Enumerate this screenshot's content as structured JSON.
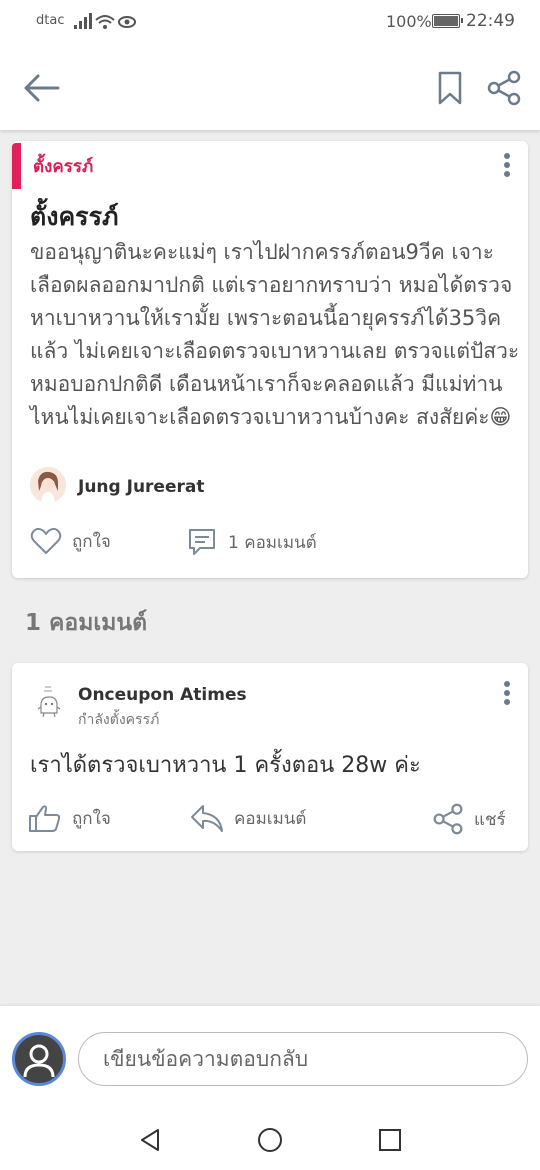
{
  "status_bar": {
    "carrier": "dtac",
    "battery": "100%",
    "battery_level": 1.0,
    "time": "22:49"
  },
  "app_bar": {
    "back_icon": "back-arrow-icon",
    "bookmark_icon": "bookmark-icon",
    "share_icon": "share-icon"
  },
  "post": {
    "tag": "ตั้งครรภ์",
    "title": "ตั้งครรภ์",
    "body": "ขออนุญาตินะคะแม่ๆ เราไปฝากครรภ์ตอน9วีค เจาะเลือดผลออกมาปกติ แต่เราอยากทราบว่า หมอได้ตรวจหาเบาหวานให้เรามั้ย เพราะตอนนี้อายุครรภ์ได้35วิคแล้ว ไม่เคยเจาะเลือดตรวจเบาหวานเลย ตรวจแต่ปัสวะหมอบอกปกติดี เดือนหน้าเราก็จะคลอดแล้ว มีแม่ท่านไหนไม่เคยเจาะเลือดตรวจเบาหวานบ้างคะ สงสัยค่ะ😁",
    "author": "Jung Jureerat",
    "like_label": "ถูกใจ",
    "comment_count_label": "1 คอมเมนต์"
  },
  "comments_section": {
    "title": "1 คอมเมนต์"
  },
  "comment": {
    "name": "Onceupon Atimes",
    "subtitle": "กำลังตั้งครรภ์",
    "text": "เราได้ตรวจเบาหวาน 1 ครั้งตอน 28w ค่ะ",
    "like_label": "ถูกใจ",
    "reply_label": "คอมเมนต์",
    "share_label": "แชร์"
  },
  "reply_bar": {
    "placeholder": "เขียนข้อความตอบกลับ"
  },
  "colors": {
    "accent": "#e0205a",
    "icon_gray": "#6b7b8c",
    "user_ring": "#5b88d6"
  }
}
